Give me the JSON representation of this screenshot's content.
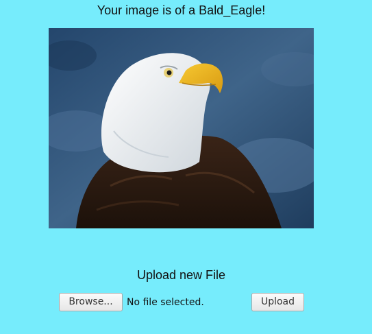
{
  "result": {
    "heading": "Your image is of a Bald_Eagle!"
  },
  "image": {
    "subject": "bald-eagle"
  },
  "upload": {
    "title": "Upload new File",
    "browse_label": "Browse...",
    "file_status": "No file selected.",
    "submit_label": "Upload"
  },
  "colors": {
    "background": "#76ecfc",
    "beak": "#f2b51d",
    "photo_background": "#2f4f6f"
  }
}
